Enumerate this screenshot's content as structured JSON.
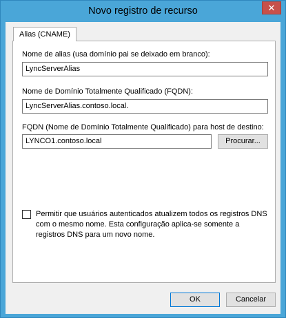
{
  "window": {
    "title": "Novo registro de recurso",
    "close_glyph": "✕"
  },
  "tab": {
    "label": "Alias (CNAME)"
  },
  "alias": {
    "label": "Nome de alias (usa domínio pai se deixado em branco):",
    "value": "LyncServerAlias"
  },
  "fqdn": {
    "label": "Nome de Domínio Totalmente Qualificado (FQDN):",
    "value": "LyncServerAlias.contoso.local."
  },
  "target": {
    "label": "FQDN (Nome de Domínio Totalmente Qualificado) para host de destino:",
    "value": "LYNCO1.contoso.local",
    "browse_label": "Procurar..."
  },
  "permission": {
    "checked": false,
    "label": "Permitir que usuários autenticados atualizem todos os registros DNS com o mesmo nome. Esta configuração aplica-se somente a registros DNS para um novo nome."
  },
  "buttons": {
    "ok_label": "OK",
    "cancel_label": "Cancelar"
  }
}
